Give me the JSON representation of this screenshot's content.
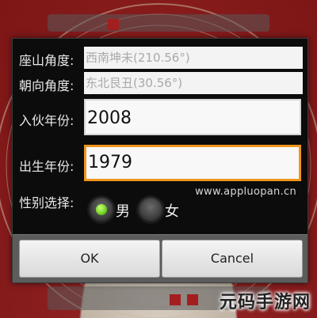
{
  "dialog": {
    "fields": {
      "mountain_angle": {
        "label": "座山角度:",
        "value": "西南坤未(210.56°)"
      },
      "facing_angle": {
        "label": "朝向角度:",
        "value": "东北艮丑(30.56°)"
      },
      "move_in_year": {
        "label": "入伙年份:",
        "value": "2008"
      },
      "birth_year": {
        "label": "出生年份:",
        "value": "1979"
      }
    },
    "gender": {
      "label": "性别选择:",
      "options": [
        {
          "label": "男",
          "selected": true
        },
        {
          "label": "女",
          "selected": false
        }
      ]
    },
    "watermark": "www.appluopan.cn",
    "buttons": {
      "ok": "OK",
      "cancel": "Cancel"
    }
  },
  "brand_logo": "元码手游网",
  "colors": {
    "focus_border": "#f0961e",
    "radio_selected": "#6fd31e",
    "dialog_bg": "#0c0c0c",
    "button_bar_bg": "#5c5c5c"
  }
}
